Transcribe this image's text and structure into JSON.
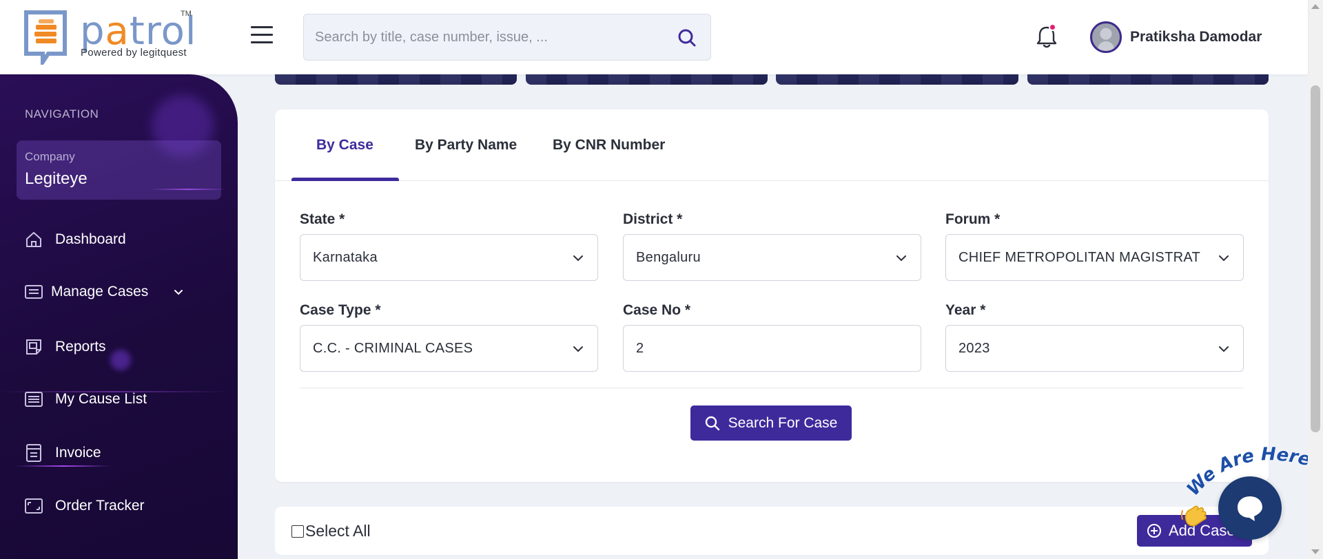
{
  "header": {
    "logo": {
      "name_prefix": "p",
      "name_accent": "a",
      "name_suffix": "trol",
      "tm": "TM",
      "powered_by": "Powered by legitquest"
    },
    "search": {
      "placeholder": "Search by title, case number, issue, ..."
    },
    "user": {
      "name": "Pratiksha Damodar"
    },
    "notification_dot_color": "#e11d73"
  },
  "sidebar": {
    "heading": "NAVIGATION",
    "company": {
      "label": "Company",
      "name": "Legiteye"
    },
    "items": [
      {
        "label": "Dashboard",
        "icon": "home-icon"
      },
      {
        "label": "Manage Cases",
        "icon": "cases-icon",
        "expandable": true
      },
      {
        "label": "Reports",
        "icon": "reports-icon"
      },
      {
        "label": "My Cause List",
        "icon": "list-icon"
      },
      {
        "label": "Invoice",
        "icon": "invoice-icon"
      },
      {
        "label": "Order Tracker",
        "icon": "tracker-icon"
      }
    ]
  },
  "search_form": {
    "tabs": [
      {
        "label": "By Case",
        "active": true
      },
      {
        "label": "By Party Name",
        "active": false
      },
      {
        "label": "By CNR Number",
        "active": false
      }
    ],
    "fields": {
      "state": {
        "label": "State *",
        "value": "Karnataka"
      },
      "district": {
        "label": "District *",
        "value": "Bengaluru"
      },
      "forum": {
        "label": "Forum *",
        "value": "CHIEF METROPOLITAN MAGISTRAT"
      },
      "case_type": {
        "label": "Case Type *",
        "value": "C.C. - CRIMINAL CASES"
      },
      "case_no": {
        "label": "Case No *",
        "value": "2"
      },
      "year": {
        "label": "Year *",
        "value": "2023"
      }
    },
    "search_button": "Search For Case"
  },
  "case_list": {
    "select_all": "Select All",
    "add_case": "Add Case"
  },
  "chat": {
    "tagline": "We Are Here!"
  },
  "colors": {
    "primary": "#3f2a9c",
    "sidebar_bg": "#1c0a3d",
    "accent_orange": "#f08a24"
  }
}
